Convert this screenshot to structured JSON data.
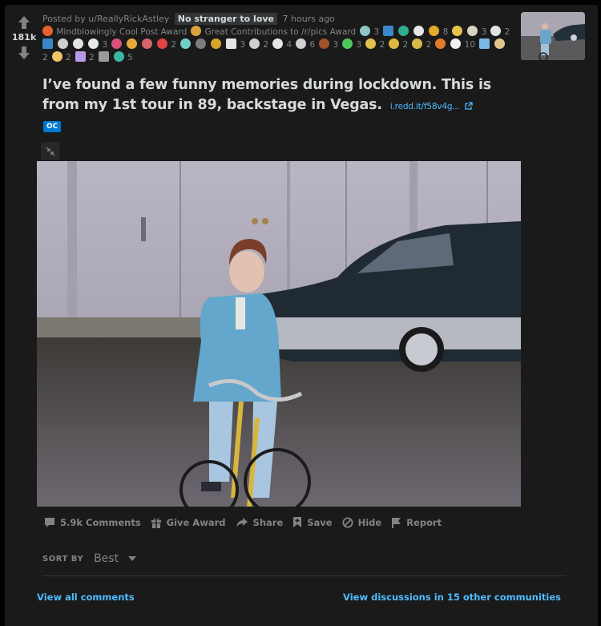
{
  "post": {
    "score": "181k",
    "posted_by_prefix": "Posted by",
    "author": "u/ReallyRickAstley",
    "author_flair": "No stranger to love",
    "time_ago": "7 hours ago",
    "named_awards": [
      {
        "icon": "mindblowingly-cool-award-icon",
        "label": "Mindblowingly Cool Post Award",
        "color": "#e8602b"
      },
      {
        "icon": "crown-award-icon",
        "label": "Great Contributions to /r/pics Award",
        "color": "#d9a23a"
      }
    ],
    "awards": [
      {
        "icon": "globe-award-icon",
        "color": "#8fc7c6",
        "count": "3"
      },
      {
        "icon": "i-award-icon",
        "color": "#3a86c8",
        "count": "",
        "square": true
      },
      {
        "icon": "frog-award-icon",
        "color": "#2fae8f",
        "count": ""
      },
      {
        "icon": "cow-award-icon",
        "color": "#e6e6e6",
        "count": ""
      },
      {
        "icon": "hexagon-award-icon",
        "color": "#e3a92c",
        "count": "8"
      },
      {
        "icon": "clapping-award-icon",
        "color": "#e6c24a",
        "count": ""
      },
      {
        "icon": "skeleton-award-icon",
        "color": "#d8d2c0",
        "count": "3"
      },
      {
        "icon": "snoo-cop-award-icon",
        "color": "#dfe3e6",
        "count": "2"
      },
      {
        "icon": "p-award-icon",
        "color": "#3a86c8",
        "count": "",
        "square": true
      },
      {
        "icon": "skull-award-icon",
        "color": "#cfcfcf",
        "count": ""
      },
      {
        "icon": "rocket-like-award-icon",
        "color": "#e4e4e4",
        "count": ""
      },
      {
        "icon": "goat-award-icon",
        "color": "#e8e8e8",
        "count": "3"
      },
      {
        "icon": "heart-award-icon",
        "color": "#d9507a",
        "count": ""
      },
      {
        "icon": "doge-award-icon",
        "color": "#e7a83a",
        "count": ""
      },
      {
        "icon": "mind-blown-award-icon",
        "color": "#d5656c",
        "count": ""
      },
      {
        "icon": "love-heart-award-icon",
        "color": "#e24345",
        "count": "2"
      },
      {
        "icon": "snoo-burst-award-icon",
        "color": "#6fd1c7",
        "count": ""
      },
      {
        "icon": "mic-drop-award-icon",
        "color": "#7c7c7c",
        "count": ""
      },
      {
        "icon": "lion-award-icon",
        "color": "#d6a52b",
        "count": ""
      },
      {
        "icon": "f-award-icon",
        "color": "#e4e4e4",
        "count": "3",
        "square": true
      },
      {
        "icon": "wholesome-seal-award-icon",
        "color": "#cfcfcf",
        "count": "2"
      },
      {
        "icon": "seal-award-icon",
        "color": "#e6e6e6",
        "count": "4"
      },
      {
        "icon": "s-award-icon",
        "color": "#d0d0d0",
        "count": "6"
      },
      {
        "icon": "bear-award-icon",
        "color": "#a0522d",
        "count": "3"
      },
      {
        "icon": "dinosaur-award-icon",
        "color": "#4fc65b",
        "count": "3"
      },
      {
        "icon": "sun-award-icon",
        "color": "#e3c14d",
        "count": "2"
      },
      {
        "icon": "laugh-award-icon",
        "color": "#ddb93f",
        "count": "2"
      },
      {
        "icon": "up-arrow-award-icon",
        "color": "#d9b84a",
        "count": "2"
      },
      {
        "icon": "hug-award-icon",
        "color": "#e27a2a",
        "count": ""
      },
      {
        "icon": "snoo-award-icon",
        "color": "#f0f0f0",
        "count": "10"
      },
      {
        "icon": "cozy-award-icon",
        "color": "#7ab6e6",
        "count": "",
        "square": true
      },
      {
        "icon": "scroll-award-icon",
        "color": "#e1c38c",
        "count": "2"
      },
      {
        "icon": "wholesome-award-icon",
        "color": "#f2c36b",
        "count": "2"
      },
      {
        "icon": "pixel-award-icon",
        "color": "#b79ae8",
        "count": "2",
        "square": true
      },
      {
        "icon": "framed-snoo-award-icon",
        "color": "#9a9a9a",
        "count": "",
        "square": true
      },
      {
        "icon": "bot-award-icon",
        "color": "#3ab8a3",
        "count": "5"
      }
    ],
    "title": "I’ve found a few funny memories during lockdown. This is from my 1st tour in 89, backstage in Vegas.",
    "domain": "i.redd.it/f58v4g...",
    "flair": "OC",
    "actions": {
      "comments": "5.9k Comments",
      "give_award": "Give Award",
      "share": "Share",
      "save": "Save",
      "hide": "Hide",
      "report": "Report"
    }
  },
  "comments": {
    "sort_by_label": "SORT BY",
    "sort_value": "Best",
    "view_all": "View all comments",
    "view_other": "View discussions in 15 other communities"
  },
  "colors": {
    "background": "#030303",
    "card": "#1a1a1b",
    "link": "#4fbcff",
    "oc_flair": "#0079d3",
    "muted": "#818384"
  }
}
